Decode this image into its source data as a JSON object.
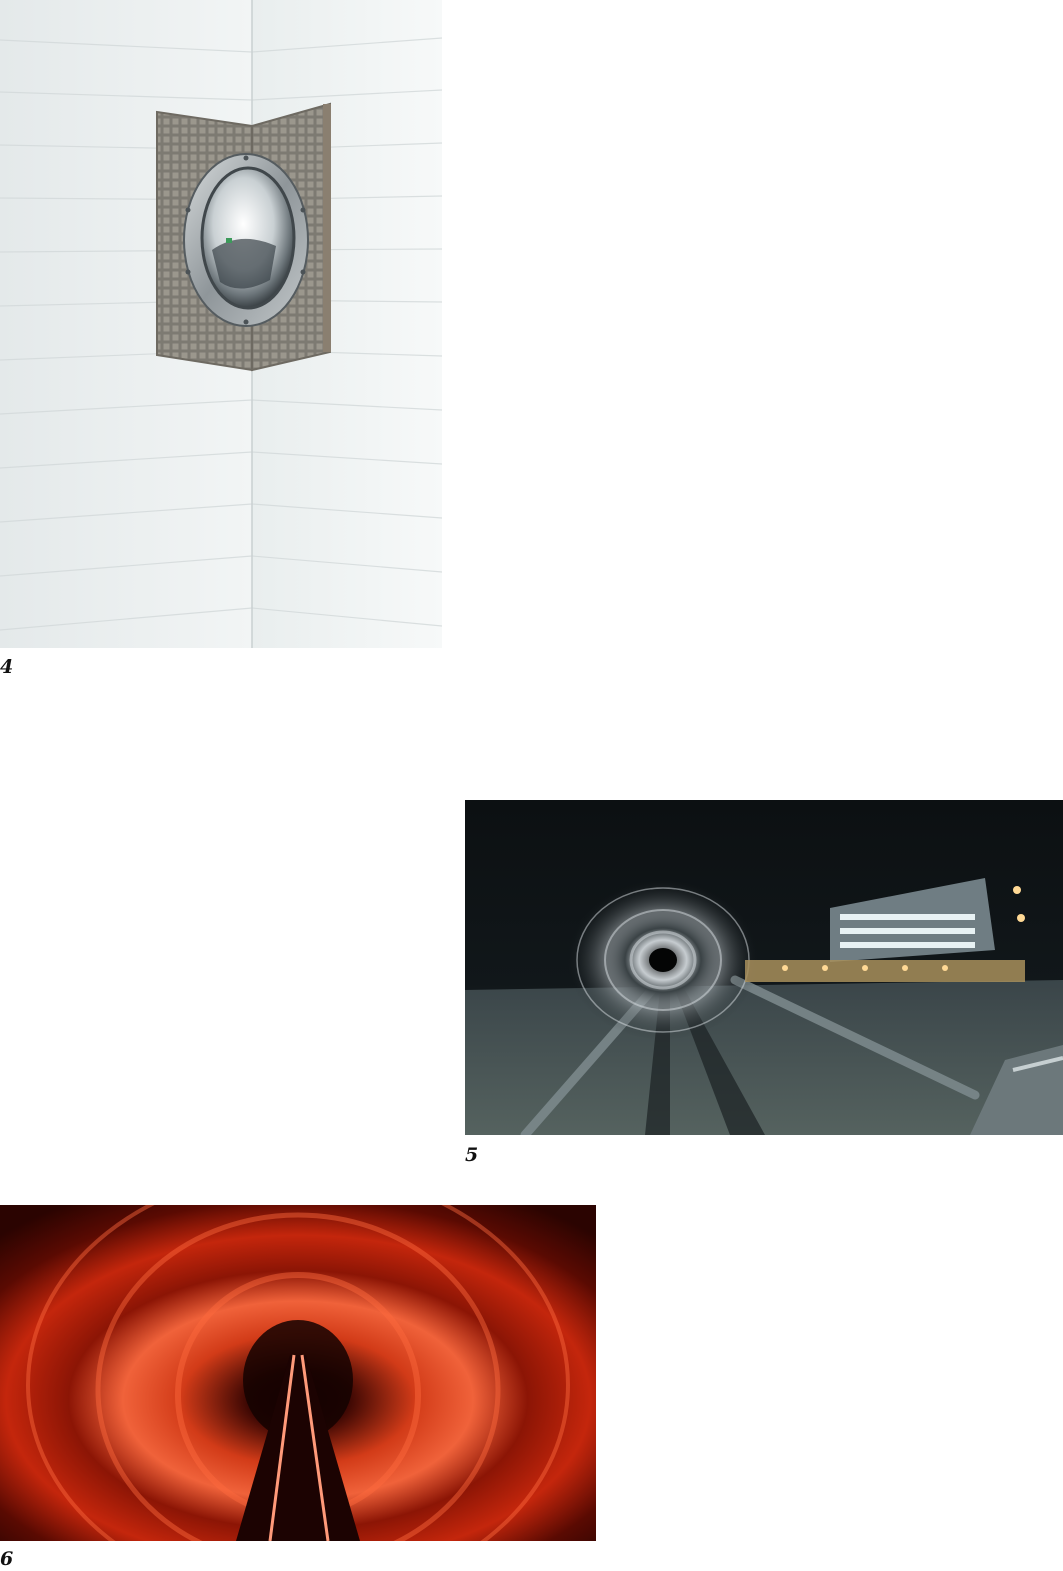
{
  "figures": [
    {
      "id": "4",
      "caption": "4"
    },
    {
      "id": "5",
      "caption": "5"
    },
    {
      "id": "6",
      "caption": "6"
    }
  ]
}
